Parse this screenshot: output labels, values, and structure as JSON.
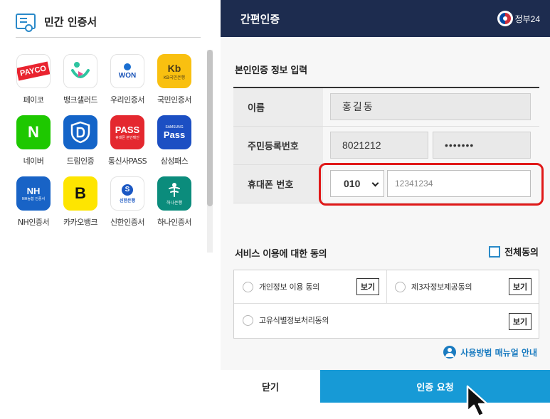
{
  "left_panel": {
    "title": "민간 인증서",
    "apps": [
      {
        "label": "페이코",
        "icon": "payco-icon",
        "mark": "PAYCO"
      },
      {
        "label": "뱅크샐러드",
        "icon": "banksalad-icon"
      },
      {
        "label": "우리인증서",
        "icon": "woori-won-icon",
        "mark": "WON"
      },
      {
        "label": "국민인증서",
        "icon": "kb-icon",
        "mark": "Kb",
        "sub": "KB국민은행"
      },
      {
        "label": "네이버",
        "icon": "naver-icon",
        "mark": "N"
      },
      {
        "label": "드림인증",
        "icon": "dream-shield-icon"
      },
      {
        "label": "통신사PASS",
        "icon": "pass-icon",
        "mark": "PASS",
        "sub": "휴대폰 본인확인"
      },
      {
        "label": "삼성패스",
        "icon": "samsung-pass-icon",
        "mark": "Pass",
        "sub": "SAMSUNG"
      },
      {
        "label": "NH인증서",
        "icon": "nh-icon",
        "mark": "NH",
        "sub": "NH농협 인증서"
      },
      {
        "label": "카카오뱅크",
        "icon": "kakaobank-icon",
        "mark": "B"
      },
      {
        "label": "신한인증서",
        "icon": "shinhan-icon",
        "mark": "S",
        "sub": "신한은행"
      },
      {
        "label": "하나인증서",
        "icon": "hana-icon",
        "sub": "하나은행"
      }
    ]
  },
  "header": {
    "title": "간편인증",
    "logo_text": "정부24"
  },
  "form": {
    "section_title": "본인인증 정보 입력",
    "name_label": "이름",
    "name_value": "홍길동",
    "rrn_label": "주민등록번호",
    "rrn_front": "8021212",
    "rrn_back": "•••••••",
    "phone_label": "휴대폰 번호",
    "phone_prefix": "010",
    "phone_placeholder": "12341234"
  },
  "agreement": {
    "section_title": "서비스 이용에 대한 동의",
    "all_agree": "전체동의",
    "items": [
      {
        "label": "개인정보 이용 동의",
        "button": "보기"
      },
      {
        "label": "제3자정보제공동의",
        "button": "보기"
      },
      {
        "label": "고유식별정보처리동의",
        "button": "보기"
      }
    ]
  },
  "manual_link": "사용방법 매뉴얼 안내",
  "buttons": {
    "close": "닫기",
    "request": "인증 요청"
  },
  "colors": {
    "header_bg": "#1d2c4f",
    "request_bg": "#179ad6",
    "highlight": "#e01919",
    "accent": "#2a89c9"
  }
}
